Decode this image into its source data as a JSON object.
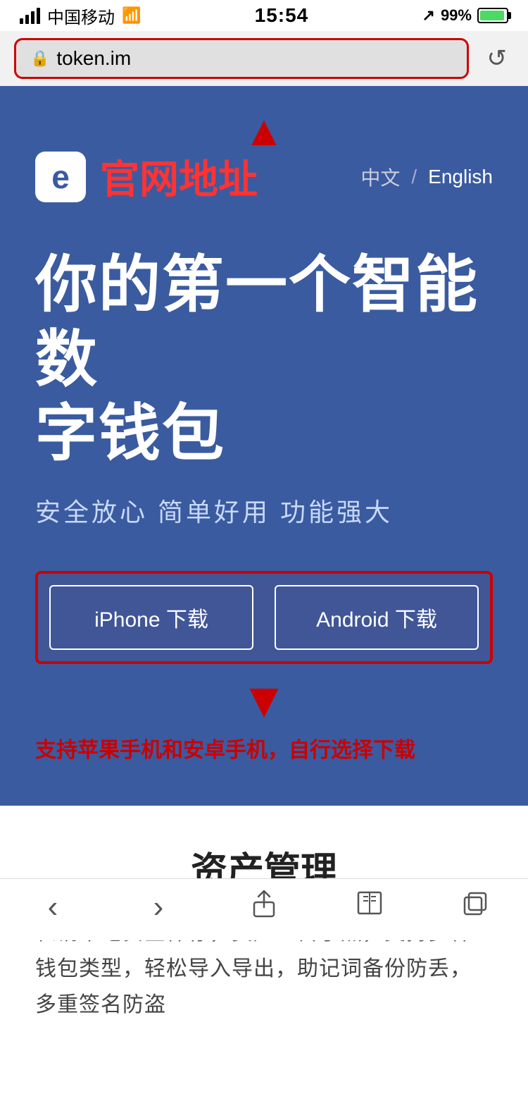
{
  "status_bar": {
    "carrier": "中国移动",
    "time": "15:54",
    "battery_pct": "99%"
  },
  "browser": {
    "url": "token.im",
    "lock_symbol": "🔒",
    "reload_symbol": "↺"
  },
  "header": {
    "logo_char": "e",
    "site_title": "官网地址",
    "lang_cn": "中文",
    "lang_divider": "/",
    "lang_en": "English"
  },
  "hero": {
    "title_line1": "你的第一个智能数",
    "title_line2": "字钱包",
    "subtitle": "安全放心  简单好用  功能强大"
  },
  "buttons": {
    "iphone": "iPhone 下载",
    "android": "Android 下载"
  },
  "annotation": {
    "bottom_text": "支持苹果手机和安卓手机，自行选择下载"
  },
  "feature": {
    "title": "资产管理",
    "desc": "私钥本地安全保存，资产一目了然，支持多种钱包类型，轻松导入导出，助记词备份防丢，多重签名防盗"
  },
  "bottom_nav": {
    "back": "‹",
    "forward": "›",
    "share": "⬆",
    "book": "📖",
    "tabs": "⧉"
  }
}
